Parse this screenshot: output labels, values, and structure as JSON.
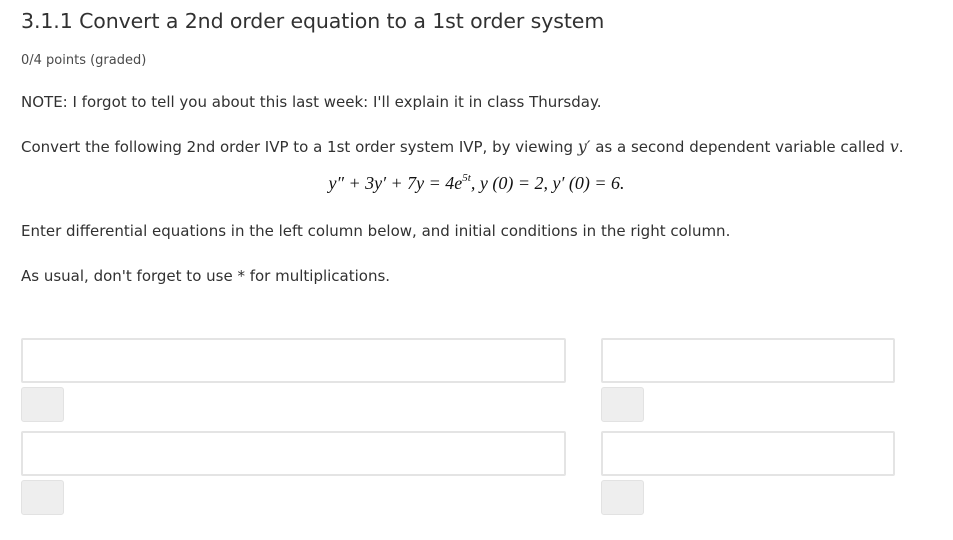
{
  "problem": {
    "title": "3.1.1 Convert a 2nd order equation to a 1st order system",
    "points": "0/4 points (graded)"
  },
  "body": {
    "note": "NOTE: I forgot to tell you about this last week: I'll explain it in class Thursday.",
    "convert_before": "Convert the following 2nd order IVP to a 1st order system IVP, by viewing ",
    "convert_var1": "y′",
    "convert_middle": " as a second dependent variable called ",
    "convert_var2": "v",
    "convert_end": ".",
    "equation_lhs": "y″ + 3y′ + 7y = 4e",
    "equation_exp": "5t",
    "equation_ic1": ",   y (0) = 2,   y′ (0) = 6.",
    "enter_text": "Enter differential equations in the left column below, and initial conditions in the right column.",
    "usual_text": "As usual, don't forget to use * for multiplications."
  },
  "answers": {
    "eq1_value": "",
    "eq2_value": "",
    "ic1_value": "",
    "ic2_value": ""
  }
}
